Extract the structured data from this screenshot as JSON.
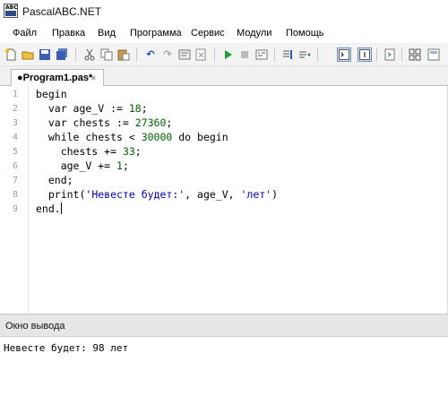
{
  "window": {
    "title": "PascalABC.NET"
  },
  "menu": [
    "Файл",
    "Правка",
    "Вид",
    "Программа",
    "Сервис",
    "Модули",
    "Помощь"
  ],
  "toolbar": {
    "icons": [
      "new-file-icon",
      "open-folder-icon",
      "save-icon",
      "save-all-icon",
      "cut-icon",
      "copy-icon",
      "paste-icon",
      "undo-icon",
      "redo-icon",
      "compile-icon",
      "run-icon",
      "stop-icon",
      "debug-icon",
      "find-icon",
      "replace-icon",
      "output-view-icon",
      "properties-icon",
      "module-icon",
      "grid-icon",
      "list-icon"
    ]
  },
  "tab": {
    "label": "●Program1.pas*",
    "close": "×"
  },
  "editor": {
    "line_numbers": [
      "1",
      "2",
      "3",
      "4",
      "5",
      "6",
      "7",
      "8",
      "9"
    ],
    "lines": [
      [
        {
          "t": "begin",
          "c": "kw"
        }
      ],
      [
        {
          "t": "  var age_V := ",
          "c": "kw"
        },
        {
          "t": "18",
          "c": "num"
        },
        {
          "t": ";",
          "c": "kw"
        }
      ],
      [
        {
          "t": "  var chests := ",
          "c": "kw"
        },
        {
          "t": "27360",
          "c": "num"
        },
        {
          "t": ";",
          "c": "kw"
        }
      ],
      [
        {
          "t": "  while chests < ",
          "c": "kw"
        },
        {
          "t": "30000",
          "c": "num"
        },
        {
          "t": " do begin",
          "c": "kw"
        }
      ],
      [
        {
          "t": "    chests += ",
          "c": "kw"
        },
        {
          "t": "33",
          "c": "num"
        },
        {
          "t": ";",
          "c": "kw"
        }
      ],
      [
        {
          "t": "    age_V += ",
          "c": "kw"
        },
        {
          "t": "1",
          "c": "num"
        },
        {
          "t": ";",
          "c": "kw"
        }
      ],
      [
        {
          "t": "  end;",
          "c": "kw"
        }
      ],
      [
        {
          "t": "  print(",
          "c": "kw"
        },
        {
          "t": "'Невесте будет:'",
          "c": "str"
        },
        {
          "t": ", age_V, ",
          "c": "kw"
        },
        {
          "t": "'лет'",
          "c": "str"
        },
        {
          "t": ")",
          "c": "kw"
        }
      ],
      [
        {
          "t": "end.",
          "c": "kw"
        }
      ]
    ]
  },
  "output": {
    "title": "Окно вывода",
    "text": "Невесте будет: 98 лет"
  },
  "colors": {
    "number": "#006400",
    "string": "#0000c0",
    "toolbar_bg": "#f3f3f3",
    "output_header_bg": "#e6e6e6"
  }
}
